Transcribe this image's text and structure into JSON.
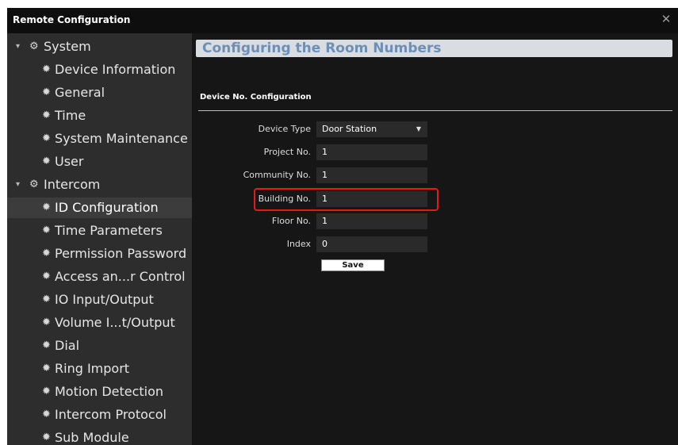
{
  "window": {
    "title": "Remote Configuration",
    "close_icon": "close-icon"
  },
  "sidebar": {
    "group_icon": "gear-group-icon",
    "item_icon": "gear-icon",
    "collapse_icon": "chevron-down-icon",
    "items": [
      {
        "label": "System",
        "type": "group"
      },
      {
        "label": "Device Information",
        "type": "child"
      },
      {
        "label": "General",
        "type": "child"
      },
      {
        "label": "Time",
        "type": "child"
      },
      {
        "label": "System Maintenance",
        "type": "child"
      },
      {
        "label": "User",
        "type": "child"
      },
      {
        "label": "Intercom",
        "type": "group"
      },
      {
        "label": "ID Configuration",
        "type": "child",
        "selected": true
      },
      {
        "label": "Time Parameters",
        "type": "child"
      },
      {
        "label": "Permission Password",
        "type": "child"
      },
      {
        "label": "Access an...r Control",
        "type": "child"
      },
      {
        "label": "IO Input/Output",
        "type": "child"
      },
      {
        "label": "Volume I...t/Output",
        "type": "child"
      },
      {
        "label": "Dial",
        "type": "child"
      },
      {
        "label": "Ring Import",
        "type": "child"
      },
      {
        "label": "Motion Detection",
        "type": "child"
      },
      {
        "label": "Intercom Protocol",
        "type": "child"
      },
      {
        "label": "Sub Module",
        "type": "child"
      }
    ]
  },
  "main": {
    "page_title": "Configuring the Room Numbers",
    "section_title": "Device No. Configuration",
    "form": {
      "device_type": {
        "label": "Device Type",
        "value": "Door Station"
      },
      "project_no": {
        "label": "Project No.",
        "value": "1"
      },
      "community_no": {
        "label": "Community No.",
        "value": "1"
      },
      "building_no": {
        "label": "Building No.",
        "value": "1"
      },
      "floor_no": {
        "label": "Floor No.",
        "value": "1"
      },
      "index": {
        "label": "Index",
        "value": "0"
      }
    },
    "save_label": "Save",
    "highlight_color": "#e81818"
  },
  "colors": {
    "background": "#161616",
    "sidebar": "#2d2d2d",
    "title_bar_text": "#ffffff",
    "page_title_bg": "#d9dde2",
    "page_title_text": "#6e8fb5"
  }
}
